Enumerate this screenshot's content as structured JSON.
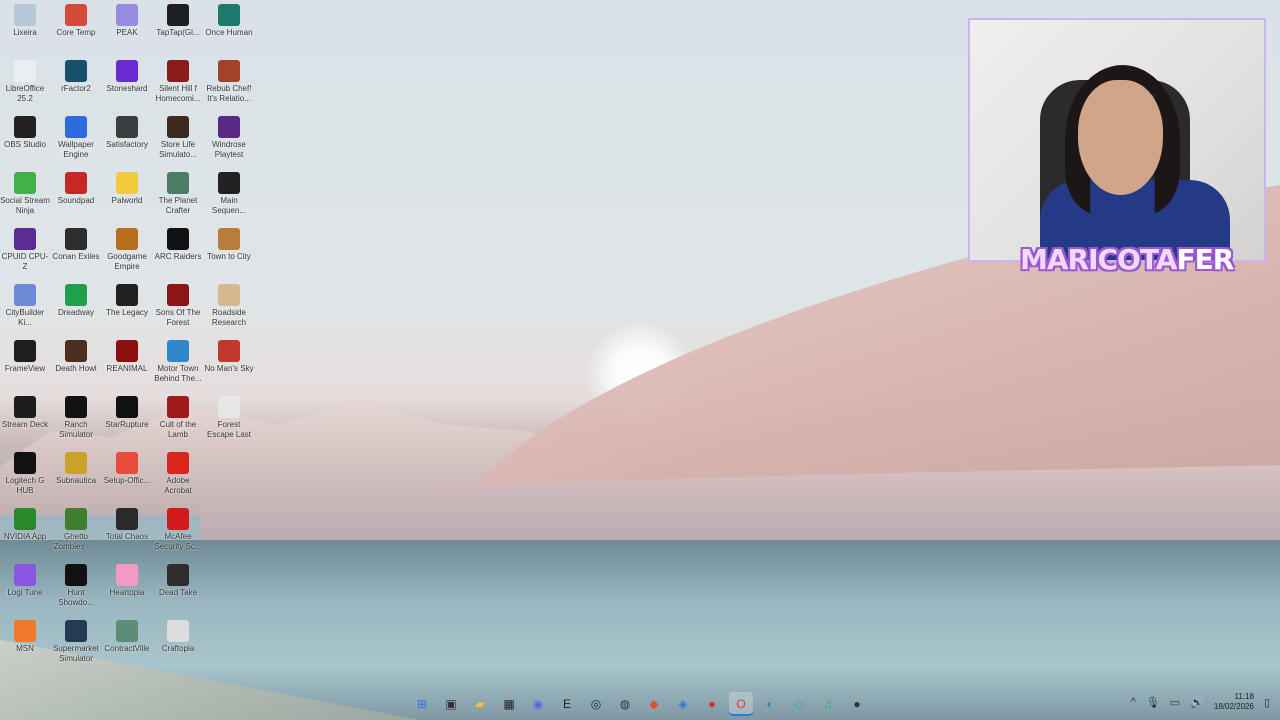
{
  "desktop_icons": [
    {
      "label": "Lixeira",
      "icon": "recycle-bin-icon",
      "color": "#b7c6d8"
    },
    {
      "label": "Core Temp",
      "icon": "thermometer-icon",
      "color": "#d64a3a"
    },
    {
      "label": "PEAK",
      "icon": "mountain-icon",
      "color": "#9a8be0"
    },
    {
      "label": "TapTap(Gl...",
      "icon": "taptap-icon",
      "color": "#1f1f1f"
    },
    {
      "label": "Once Human",
      "icon": "once-human-icon",
      "color": "#1d7a6d"
    },
    {
      "label": "LibreOffice 25.2",
      "icon": "document-icon",
      "color": "#e9eef1"
    },
    {
      "label": "rFactor2",
      "icon": "r-letter-icon",
      "color": "#1a4f6b"
    },
    {
      "label": "Stoneshard",
      "icon": "gem-icon",
      "color": "#6a2ad1"
    },
    {
      "label": "Silent Hill f Homecomi...",
      "icon": "silent-hill-icon",
      "color": "#8b1b1b"
    },
    {
      "label": "Rebub Chef! It's Relatio...",
      "icon": "chef-icon",
      "color": "#a4412b"
    },
    {
      "label": "OBS Studio",
      "icon": "obs-icon",
      "color": "#222"
    },
    {
      "label": "Wallpaper Engine",
      "icon": "wallpaper-engine-icon",
      "color": "#2c6bdc"
    },
    {
      "label": "Satisfactory",
      "icon": "satisfactory-icon",
      "color": "#3d3d3d"
    },
    {
      "label": "Store Life Simulato...",
      "icon": "store-icon",
      "color": "#3b2a1d"
    },
    {
      "label": "Windrose Playtest",
      "icon": "w-letter-icon",
      "color": "#5a2a83"
    },
    {
      "label": "Social Stream Ninja",
      "icon": "ninja-icon",
      "color": "#43b04a"
    },
    {
      "label": "Soundpad",
      "icon": "soundpad-icon",
      "color": "#c62828"
    },
    {
      "label": "Palworld",
      "icon": "palworld-icon",
      "color": "#f0c93c"
    },
    {
      "label": "The Planet Crafter",
      "icon": "planet-icon",
      "color": "#4c7c62"
    },
    {
      "label": "Main Sequen...",
      "icon": "gear-icon",
      "color": "#222"
    },
    {
      "label": "CPUID CPU-Z",
      "icon": "cpu-icon",
      "color": "#5b2c91"
    },
    {
      "label": "Conan Exiles",
      "icon": "conan-icon",
      "color": "#2e2e2e"
    },
    {
      "label": "Goodgame Empire",
      "icon": "castle-icon",
      "color": "#b86d1e"
    },
    {
      "label": "ARC Raiders",
      "icon": "arc-icon",
      "color": "#111"
    },
    {
      "label": "Town to City",
      "icon": "town-icon",
      "color": "#b87d3d"
    },
    {
      "label": "CityBuilder Ki...",
      "icon": "city-icon",
      "color": "#6d8ad6"
    },
    {
      "label": "Dreadway",
      "icon": "dreadway-icon",
      "color": "#1ea14a"
    },
    {
      "label": "The Legacy",
      "icon": "legacy-icon",
      "color": "#222"
    },
    {
      "label": "Sons Of The Forest",
      "icon": "forest-icon",
      "color": "#8d1515"
    },
    {
      "label": "Roadside Research",
      "icon": "face-icon",
      "color": "#d6b98e"
    },
    {
      "label": "FrameView",
      "icon": "frameview-icon",
      "color": "#1f1f1f"
    },
    {
      "label": "Death Howl",
      "icon": "howl-icon",
      "color": "#4a2f1f"
    },
    {
      "label": "REANIMAL",
      "icon": "reanimal-icon",
      "color": "#8d0f0f"
    },
    {
      "label": "Motor Town Behind The...",
      "icon": "motor-town-icon",
      "color": "#2f87c9"
    },
    {
      "label": "No Man's Sky",
      "icon": "nms-icon",
      "color": "#c0392b"
    },
    {
      "label": "Stream Deck",
      "icon": "stream-deck-icon",
      "color": "#1d1d1d"
    },
    {
      "label": "Ranch Simulator",
      "icon": "ranch-icon",
      "color": "#111"
    },
    {
      "label": "StarRupture",
      "icon": "sr-icon",
      "color": "#111"
    },
    {
      "label": "Cult of the Lamb",
      "icon": "lamb-icon",
      "color": "#9e1b1b"
    },
    {
      "label": "Forest Escape Last Train P...",
      "icon": "train-icon",
      "color": "#e6e6e6"
    },
    {
      "label": "Logitech G HUB",
      "icon": "logitech-icon",
      "color": "#111"
    },
    {
      "label": "Subnautica",
      "icon": "subnautica-icon",
      "color": "#c9a227"
    },
    {
      "label": "Setup-Offic...",
      "icon": "office-icon",
      "color": "#e74c3c"
    },
    {
      "label": "Adobe Acrobat",
      "icon": "acrobat-icon",
      "color": "#d9261c"
    },
    {
      "label": "",
      "icon": "",
      "color": ""
    },
    {
      "label": "NVIDIA App",
      "icon": "nvidia-icon",
      "color": "#2a8a2a"
    },
    {
      "label": "Ghetto Zombies - ...",
      "icon": "zombie-icon",
      "color": "#3f7f2f"
    },
    {
      "label": "Total Chaos",
      "icon": "chaos-icon",
      "color": "#2a2a2a"
    },
    {
      "label": "McAfee Security Sc...",
      "icon": "mcafee-icon",
      "color": "#d11b1b"
    },
    {
      "label": "",
      "icon": "",
      "color": ""
    },
    {
      "label": "Logi Tune",
      "icon": "logi-tune-icon",
      "color": "#8a57e0"
    },
    {
      "label": "Hunt Showdo...",
      "icon": "hunt-icon",
      "color": "#111"
    },
    {
      "label": "Heartopia",
      "icon": "heart-icon",
      "color": "#f29ac2"
    },
    {
      "label": "Dead Take",
      "icon": "dead-take-icon",
      "color": "#2d2d2d"
    },
    {
      "label": "",
      "icon": "",
      "color": ""
    },
    {
      "label": "MSN",
      "icon": "msn-icon",
      "color": "#f07a2b"
    },
    {
      "label": "Supermarket Simulator",
      "icon": "supermarket-icon",
      "color": "#263a56"
    },
    {
      "label": "ContractVille",
      "icon": "cv-icon",
      "color": "#5b8d77"
    },
    {
      "label": "Craftopia",
      "icon": "craftopia-icon",
      "color": "#ddd"
    },
    {
      "label": "",
      "icon": "",
      "color": ""
    }
  ],
  "overlay": {
    "brand_part1": "MARICOTA",
    "brand_part2": "FER"
  },
  "taskbar": {
    "apps": [
      {
        "name": "start-button",
        "icon": "windows-icon",
        "glyph": "⊞",
        "color": "#2b79d8"
      },
      {
        "name": "task-view-button",
        "icon": "task-view-icon",
        "glyph": "▣",
        "color": "#333"
      },
      {
        "name": "file-explorer-button",
        "icon": "folder-icon",
        "glyph": "▰",
        "color": "#f1c232"
      },
      {
        "name": "stream-deck-button",
        "icon": "stream-deck-icon",
        "glyph": "▦",
        "color": "#222"
      },
      {
        "name": "discord-button",
        "icon": "discord-icon",
        "glyph": "◉",
        "color": "#5865f2"
      },
      {
        "name": "epic-games-button",
        "icon": "epic-icon",
        "glyph": "E",
        "color": "#222"
      },
      {
        "name": "steam-button",
        "icon": "steam-icon",
        "glyph": "◎",
        "color": "#1b2838"
      },
      {
        "name": "obs-button",
        "icon": "obs-icon",
        "glyph": "◍",
        "color": "#333"
      },
      {
        "name": "brave-button",
        "icon": "brave-icon",
        "glyph": "◆",
        "color": "#e2502b"
      },
      {
        "name": "app-button",
        "icon": "app-icon",
        "glyph": "◈",
        "color": "#2a7ae2"
      },
      {
        "name": "chrome-button",
        "icon": "chrome-icon",
        "glyph": "●",
        "color": "#d93025"
      },
      {
        "name": "opera-button",
        "icon": "opera-icon",
        "glyph": "O",
        "color": "#e53935"
      },
      {
        "name": "edge-button",
        "icon": "edge-icon",
        "glyph": "◐",
        "color": "#1f8ccf"
      },
      {
        "name": "app2-button",
        "icon": "app2-icon",
        "glyph": "◇",
        "color": "#24b39b"
      },
      {
        "name": "spotify-button",
        "icon": "spotify-icon",
        "glyph": "♫",
        "color": "#1db954"
      },
      {
        "name": "app3-button",
        "icon": "app3-icon",
        "glyph": "●",
        "color": "#333"
      }
    ],
    "tray": {
      "chevron": "^",
      "time": "11:18",
      "date": "18/02/2026"
    }
  }
}
